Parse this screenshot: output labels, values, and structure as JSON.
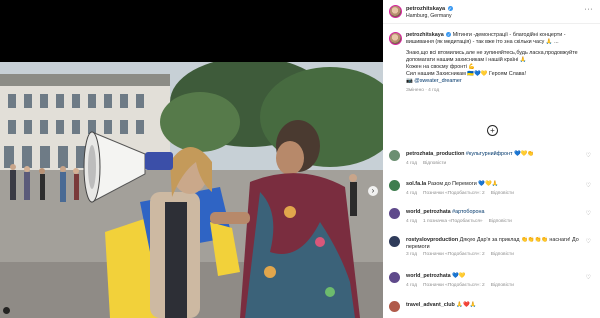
{
  "post": {
    "username": "petrozhitskaya",
    "location": "Hamburg, Germany",
    "more_icon": "more-dots-icon"
  },
  "caption": {
    "username": "petrozhitskaya",
    "line1": "Мітинги -демонстрації - благодійні концерти - вишивання (як медитація) - так вже іто зна скільки часу 🙏 ...",
    "line2": "Знаю,що всі втомились,але не зупиняйтесь,будь ласка,продовжуйте допомагати нашим захисникам і нашій країні 🙏",
    "line3": "Кожен на своєму фронті 💪",
    "line4": "Сил нашим Захисникам 🇺🇦💙💛 Героям Слава!",
    "mention": "@sweater_dreamer",
    "edited": "Змінено · 4 год"
  },
  "load_more_icon": "plus-circle-icon",
  "comments": [
    {
      "username": "petrozhata_production",
      "text": "#культурнийфронт 💙💛👏",
      "time": "4 год",
      "likes": "",
      "reply": "Відповісти",
      "color": "#6b8f71"
    },
    {
      "username": "sol.fa.la",
      "text": "Разом до Перемоги 💙💛🙏",
      "time": "4 год",
      "likes": "Позначки «Подобається»: 2",
      "reply": "Відповісти",
      "color": "#3f7d4e"
    },
    {
      "username": "world_petrozhata",
      "text": "#артоборона",
      "time": "4 год",
      "likes": "1 позначка «Подобається»",
      "reply": "Відповісти",
      "color": "#5f4a8b"
    },
    {
      "username": "rostyslovproduction",
      "text": "Дякую Дар'я за приклад 👏👏👏👏 наснаги! До перемоги",
      "time": "3 год",
      "likes": "Позначки «Подобається»: 2",
      "reply": "Відповісти",
      "color": "#2f3b5a"
    },
    {
      "username": "world_petrozhata",
      "text": "💙💛",
      "time": "4 год",
      "likes": "Позначки «Подобається»: 2",
      "reply": "Відповісти",
      "color": "#5f4a8b"
    },
    {
      "username": "travel_advant_club",
      "text": "🙏❤️🙏",
      "time": "",
      "likes": "",
      "reply": "",
      "color": "#b05a4a"
    }
  ],
  "colors": {
    "verified": "#3897f0",
    "link": "#00376b",
    "flag_blue": "#2f64c4",
    "flag_yellow": "#f2d13a"
  }
}
